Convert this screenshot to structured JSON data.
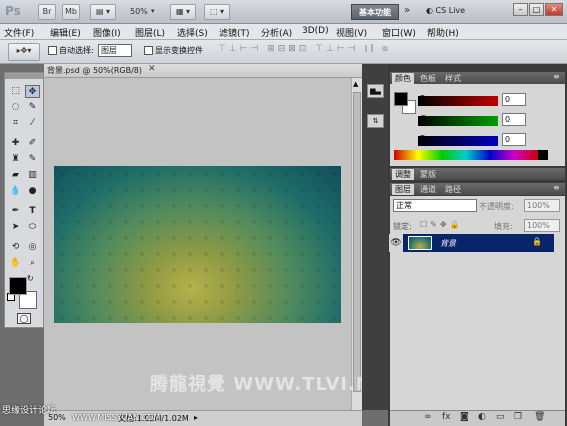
{
  "app": {
    "logo": "Ps",
    "mode_label": "Mb",
    "zoom": "50%"
  },
  "workspace": {
    "label": "基本功能",
    "more": "»",
    "cslive": "CS Live"
  },
  "window_controls": {
    "minimize": "–",
    "restore": "□",
    "close": "✕"
  },
  "menu": [
    "文件(F)",
    "编辑(E)",
    "图像(I)",
    "图层(L)",
    "选择(S)",
    "滤镜(T)",
    "分析(A)",
    "3D(D)",
    "视图(V)",
    "窗口(W)",
    "帮助(H)"
  ],
  "options": {
    "auto_select": "自动选择:",
    "auto_select_value": "图层",
    "show_transform": "显示变换控件"
  },
  "document": {
    "tab_title": "背景.psd @ 50%(RGB/8)",
    "zoom_status": "50%",
    "doc_size": "文档:1.02M/1.02M"
  },
  "color_panel": {
    "tabs": [
      "颜色",
      "色板",
      "样式"
    ],
    "channels": [
      {
        "label": "R",
        "value": "0",
        "color": "#c00000"
      },
      {
        "label": "G",
        "value": "0",
        "color": "#00a000"
      },
      {
        "label": "B",
        "value": "0",
        "color": "#0000c0"
      }
    ]
  },
  "adjust_panel": {
    "tabs": [
      "调整",
      "蒙版"
    ]
  },
  "layers_panel": {
    "tabs": [
      "图层",
      "通道",
      "路径"
    ],
    "blend_mode": "正常",
    "opacity_label": "不透明度:",
    "opacity": "100%",
    "lock_label": "锁定:",
    "fill_label": "填充:",
    "fill": "100%",
    "layers": [
      {
        "name": "背景",
        "locked": true
      }
    ]
  },
  "watermark": {
    "text": "腾龍視覺 WWW.TLVI.NET",
    "corner": "思缘设计论坛",
    "corner_url": "WWW.MISSYUAN.COM"
  },
  "fg_color": "#000000",
  "bg_color": "#ffffff",
  "accent_selected": "#0a246a"
}
